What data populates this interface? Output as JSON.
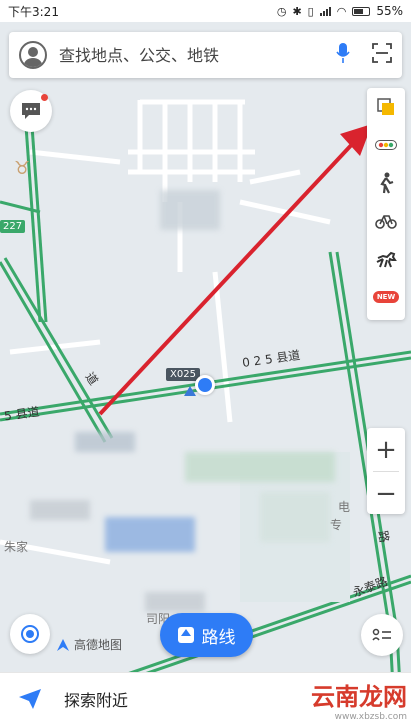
{
  "status_bar": {
    "time": "下午3:21",
    "battery": "55%"
  },
  "search": {
    "placeholder": "查找地点、公交、地铁"
  },
  "map": {
    "road_labels": {
      "county_road_right": "0 2 5 县道",
      "county_road_left": "5 县道",
      "road_code": "X025",
      "road_code_green": "227",
      "yongtai_road": "永泰路",
      "vertical_road": "道",
      "side_road": "路",
      "place_left": "朱家",
      "place_right": "电",
      "place_right2": "专",
      "place_bottom": "司阳"
    }
  },
  "toolbar": {
    "layers": "layers-icon",
    "traffic": "traffic-icon",
    "walk": "walk-icon",
    "bike": "bike-icon",
    "horse": "horse-icon",
    "new_badge": "NEW"
  },
  "zoom": {
    "in_label": "+",
    "out_label": "−"
  },
  "logo": {
    "text": "高德地图"
  },
  "route": {
    "label": "路线"
  },
  "bottom": {
    "label": "探索附近"
  },
  "watermark": {
    "text": "云南龙网",
    "sub": "www.xbzsb.com"
  },
  "colors": {
    "accent": "#2e7cf6",
    "road_green": "#3aa86a",
    "arrow_red": "#d9232e"
  }
}
